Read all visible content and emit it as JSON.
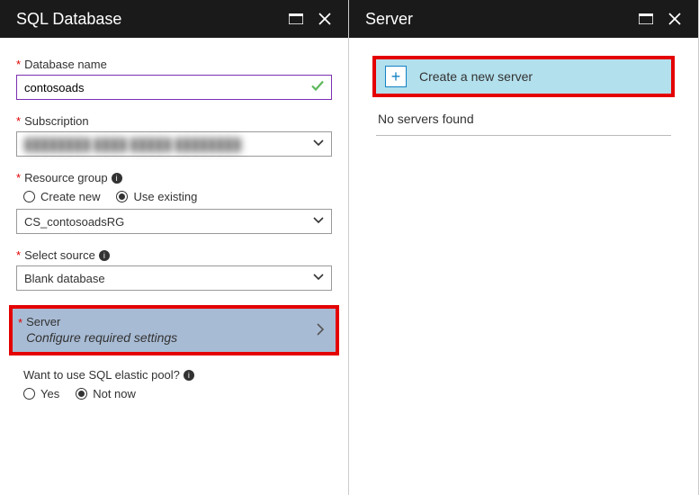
{
  "leftBlade": {
    "title": "SQL Database",
    "databaseName": {
      "label": "Database name",
      "value": "contosoads",
      "valid": true
    },
    "subscription": {
      "label": "Subscription",
      "value": "████████ ████ █████ ████████"
    },
    "resourceGroup": {
      "label": "Resource group",
      "options": {
        "createNew": "Create new",
        "useExisting": "Use existing"
      },
      "selected": "useExisting",
      "value": "CS_contosoadsRG"
    },
    "selectSource": {
      "label": "Select source",
      "value": "Blank database"
    },
    "server": {
      "label": "Server",
      "subtext": "Configure required settings"
    },
    "elasticPool": {
      "question": "Want to use SQL elastic pool?",
      "options": {
        "yes": "Yes",
        "notNow": "Not now"
      },
      "selected": "notNow"
    }
  },
  "rightBlade": {
    "title": "Server",
    "createNew": "Create a new server",
    "emptyText": "No servers found"
  }
}
